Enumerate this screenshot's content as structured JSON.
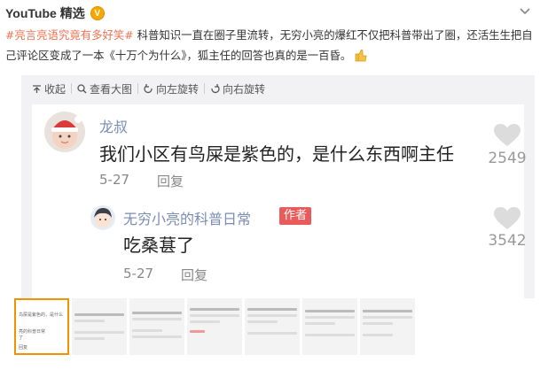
{
  "post": {
    "author": "YouTube 精选",
    "verified_badge": "V",
    "topic": "#亮言亮语究竟有多好笑#",
    "body": " 科普知识一直在圈子里流转，无穷小亮的爆红不仅把科普带出了圈，还活生生把自己评论区变成了一本《十万个为什么》，狐主任的回答也真的是一百昏。"
  },
  "toolbar": {
    "collapse": "收起",
    "view_large": "查看大图",
    "rotate_left": "向左旋转",
    "rotate_right": "向右旋转"
  },
  "comments": [
    {
      "user": "龙叔",
      "text": "我们小区有鸟屎是紫色的，是什么东西啊主任",
      "date": "5-27",
      "reply": "回复",
      "likes": "2549"
    },
    {
      "user": "无穷小亮的科普日常",
      "tag": "作者",
      "text": "吃桑葚了",
      "date": "5-27",
      "reply": "回复",
      "likes": "3542"
    }
  ],
  "thumbnail_strip": {
    "active_preview": [
      "鸟屎是紫色的，是什么",
      "亮的科普日常",
      "了",
      "回复"
    ]
  },
  "colors": {
    "topic": "#eb7350",
    "username": "#7b8db3",
    "author_tag": "#e95a5a",
    "active_thumb_border": "#f29100",
    "viewer_bg": "#f2f2f5"
  }
}
